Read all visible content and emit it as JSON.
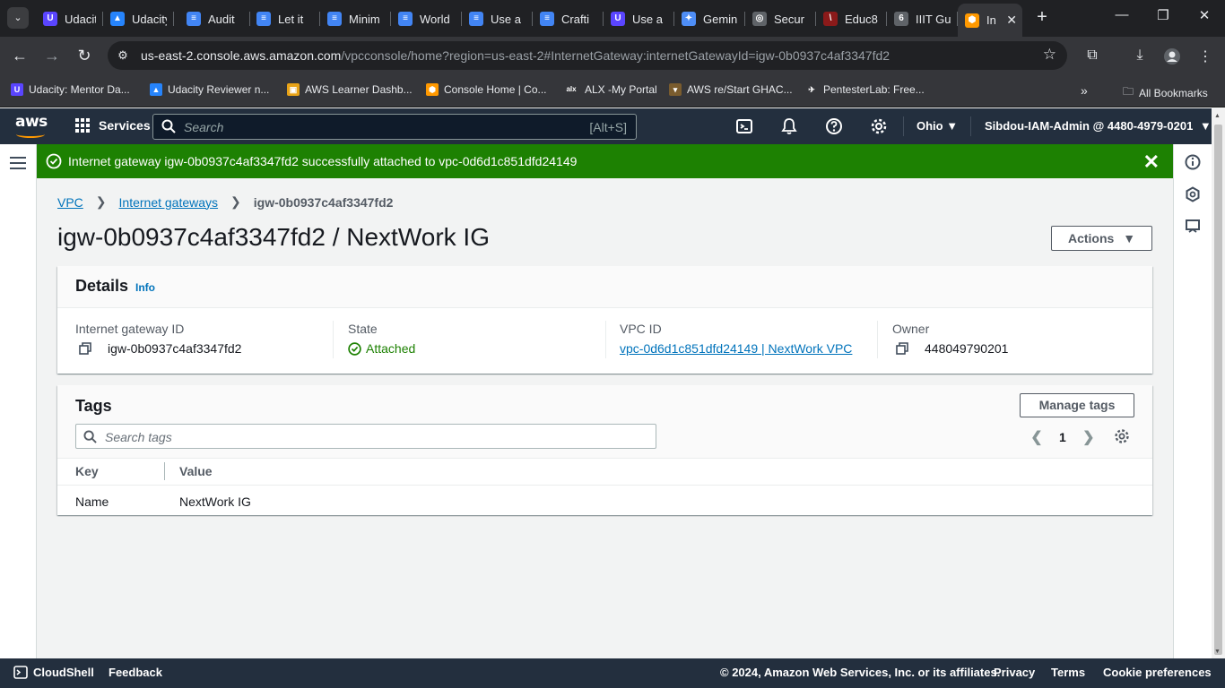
{
  "browser": {
    "tabs": [
      {
        "title": "Udacity",
        "fav": "U",
        "favcolor": "#5a45ff"
      },
      {
        "title": "Udacity",
        "fav": "▲",
        "favcolor": "#2684fc"
      },
      {
        "title": "Audit",
        "fav": "≡",
        "favcolor": "#4285f4"
      },
      {
        "title": "Let it",
        "fav": "≡",
        "favcolor": "#4285f4"
      },
      {
        "title": "Minim",
        "fav": "≡",
        "favcolor": "#4285f4"
      },
      {
        "title": "World",
        "fav": "≡",
        "favcolor": "#4285f4"
      },
      {
        "title": "Use a",
        "fav": "≡",
        "favcolor": "#4285f4"
      },
      {
        "title": "Crafti",
        "fav": "≡",
        "favcolor": "#4285f4"
      },
      {
        "title": "Use a",
        "fav": "U",
        "favcolor": "#5a45ff"
      },
      {
        "title": "Gemin",
        "fav": "✦",
        "favcolor": "#4e8ef7"
      },
      {
        "title": "Secur",
        "fav": "◎",
        "favcolor": "#5f6368"
      },
      {
        "title": "Educ8",
        "fav": "\\",
        "favcolor": "#8b1a1a"
      },
      {
        "title": "IIIT Gu",
        "fav": "6",
        "favcolor": "#5f6368"
      },
      {
        "title": "In",
        "fav": "⬢",
        "favcolor": "#ff9900"
      }
    ],
    "url_host": "us-east-2.console.aws.amazon.com",
    "url_path": "/vpcconsole/home?region=us-east-2#InternetGateway:internetGatewayId=igw-0b0937c4af3347fd2",
    "bookmarks": [
      {
        "label": "Udacity: Mentor Da...",
        "fav": "U",
        "favcolor": "#5a45ff"
      },
      {
        "label": "Udacity Reviewer n...",
        "fav": "▲",
        "favcolor": "#2684fc"
      },
      {
        "label": "AWS Learner Dashb...",
        "fav": "▣",
        "favcolor": "#e8a317"
      },
      {
        "label": "Console Home | Co...",
        "fav": "⬢",
        "favcolor": "#ff9900"
      },
      {
        "label": "ALX -My Portal",
        "fav": "alx",
        "favcolor": "#35363a"
      },
      {
        "label": "AWS re/Start GHAC...",
        "fav": "▾",
        "favcolor": "#7a5c2e"
      },
      {
        "label": "PentesterLab: Free...",
        "fav": "✈",
        "favcolor": "#35363a"
      }
    ],
    "all_bookmarks": "All Bookmarks"
  },
  "aws": {
    "logo": "aws",
    "services": "Services",
    "search_placeholder": "Search",
    "search_shortcut": "[Alt+S]",
    "region": "Ohio",
    "account": "Sibdou-IAM-Admin @ 4480-4979-0201"
  },
  "flash": {
    "message": "Internet gateway igw-0b0937c4af3347fd2 successfully attached to vpc-0d6d1c851dfd24149"
  },
  "breadcrumb": {
    "vpc": "VPC",
    "igws": "Internet gateways",
    "current": "igw-0b0937c4af3347fd2"
  },
  "page": {
    "title": "igw-0b0937c4af3347fd2 / NextWork IG",
    "actions": "Actions"
  },
  "details": {
    "heading": "Details",
    "info": "Info",
    "igw_label": "Internet gateway ID",
    "igw_value": "igw-0b0937c4af3347fd2",
    "state_label": "State",
    "state_value": "Attached",
    "vpc_label": "VPC ID",
    "vpc_value": "vpc-0d6d1c851dfd24149 | NextWork VPC",
    "owner_label": "Owner",
    "owner_value": "448049790201"
  },
  "tags": {
    "heading": "Tags",
    "manage": "Manage tags",
    "search_placeholder": "Search tags",
    "page": "1",
    "col_key": "Key",
    "col_value": "Value",
    "rows": [
      {
        "key": "Name",
        "value": "NextWork IG"
      }
    ]
  },
  "footer": {
    "cloudshell": "CloudShell",
    "feedback": "Feedback",
    "copyright": "© 2024, Amazon Web Services, Inc. or its affiliates.",
    "privacy": "Privacy",
    "terms": "Terms",
    "cookies": "Cookie preferences"
  }
}
